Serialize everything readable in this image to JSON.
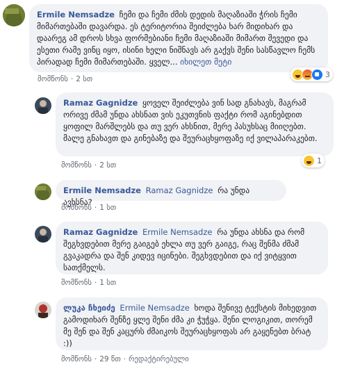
{
  "comments": [
    {
      "author": "Ermile Nemsadze",
      "mention": "",
      "text": "ჩემი და ჩემი ძმის დედის მაღაზიაში ჭრის ჩემი მიმართებაში დავარდა. ეს ტერიტორია შეიძლება ხარ მიდიხარ და დაარეგ ამ დროს სხვა ფორმებიანი ჩემი მაღაზიაში მიმართ შევედი და ესეთი რამე ვინც იყო, ისინი ხელი ნიშნავს არ გაქვს შენი სასწავლო ჩემს პირადად ჩემი მიმართებაში. ყველ...",
      "more_link": "იხილეთ მეტი",
      "like_label": "მომწონს",
      "time": "2 სთ",
      "reactions_count": "3"
    },
    {
      "author": "Ramaz Gagnidze",
      "mention": "",
      "text": "ყოველ შეიძლება ვინ სად გნახავს, მაგრამ ორივე ძმამ უნდა ახსნათ ვის ეკუთვნის ფაქტი რომ აგინებდით ყოფილ მარშლებს და თუ ვერ ახსნით, მერე პასუხსაც მიიღებთ. მალე გნახავთ და გინებაზე და შეურაცხყოფაზე იქ ვილაპარაკებთ.",
      "more_link": "",
      "like_label": "მომწონს",
      "time": "2 სთ",
      "reactions_count": "1"
    },
    {
      "author": "Ermile Nemsadze",
      "mention": "Ramaz Gagnidze",
      "text": "რა უნდა ავხსნა?",
      "more_link": "",
      "like_label": "მომწონს",
      "time": "1 სთ",
      "reactions_count": ""
    },
    {
      "author": "Ramaz Gagnidze",
      "mention": "Ermile Nemsadze",
      "text": "რა უნდა ახსნა და რომ შეგხვდებით მერე გაიგებ ეხლა თუ ვერ გაიგე, რაც შენმა ძმამ გვაკადრა და შენ კიდევ იცინები. შეგხვდებით და იქ ვიტყვით სათქმელს.",
      "more_link": "",
      "like_label": "მომწონს",
      "time": "1 სთ",
      "reactions_count": ""
    },
    {
      "author": "ლუკა ჩხეიძე",
      "mention": "Ermile Nemsadze",
      "text": "ხოდა შენივე ტექსტის მიხედვით გამოდიხარ შენზე ყლე შენი ძმა კი ჭუჭყა. შენი ლოგიკით, თორემ მე შენ და შენ კაცურს ძმაიკოს შეურაცხყოფას არ გაყენებთ ბრატ :))",
      "more_link": "",
      "like_label": "მომწონს",
      "time": "29 წთ",
      "edited": "რედაქტირებული",
      "reactions_count": ""
    }
  ],
  "colors": {
    "link": "#385898",
    "bubble": "#f0f2f5",
    "meta": "#606770"
  }
}
